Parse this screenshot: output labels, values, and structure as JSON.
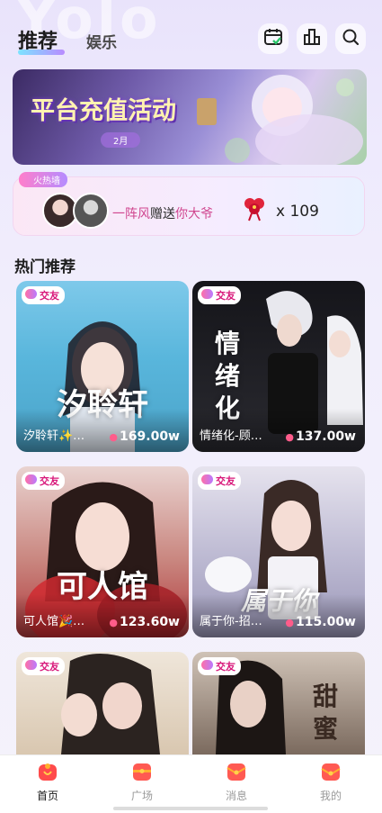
{
  "header": {
    "watermark": "Yolo",
    "tabs": [
      {
        "label": "推荐",
        "active": true
      },
      {
        "label": "娱乐",
        "active": false
      }
    ],
    "icons": [
      "calendar-check-icon",
      "building-icon",
      "search-icon"
    ]
  },
  "banner": {
    "title": "平台充值活动",
    "month": "2月"
  },
  "hot_wall": {
    "tag": "火热墙",
    "sender": "一阵风",
    "action": "赠送",
    "receiver": "你大爷",
    "gift_icon": "red-knot-gift-icon",
    "count": "x 109"
  },
  "section": {
    "title": "热门推荐"
  },
  "cards": [
    {
      "badge": "交友",
      "big_word": "汐聆轩",
      "name": "汐聆轩✨…",
      "hot": "169.00w",
      "bg": "#56b7d9"
    },
    {
      "badge": "交友",
      "big_word": "情绪化",
      "name": "情绪化-顾…",
      "hot": "137.00w",
      "bg": "#202025"
    },
    {
      "badge": "交友",
      "big_word": "可人馆",
      "name": "可人馆🎉…",
      "hot": "123.60w",
      "bg": "#c9747a"
    },
    {
      "badge": "交友",
      "big_word": "属于你",
      "name": "属于你-招…",
      "hot": "115.00w",
      "bg": "#b8b4cf"
    },
    {
      "badge": "交友",
      "big_word": "",
      "name": "",
      "hot": "",
      "bg": "#d8c9b2"
    },
    {
      "badge": "交友",
      "big_word": "甜蜜",
      "name": "",
      "hot": "",
      "bg": "#5a4a40"
    }
  ],
  "bottom_nav": [
    {
      "label": "首页",
      "icon": "home-gift-icon",
      "active": true
    },
    {
      "label": "广场",
      "icon": "plaza-gift-icon",
      "active": false
    },
    {
      "label": "消息",
      "icon": "message-gift-icon",
      "active": false
    },
    {
      "label": "我的",
      "icon": "profile-gift-icon",
      "active": false
    }
  ],
  "colors": {
    "accent_pink": "#d0468f",
    "nav_icon_red": "#ff4b4b"
  }
}
